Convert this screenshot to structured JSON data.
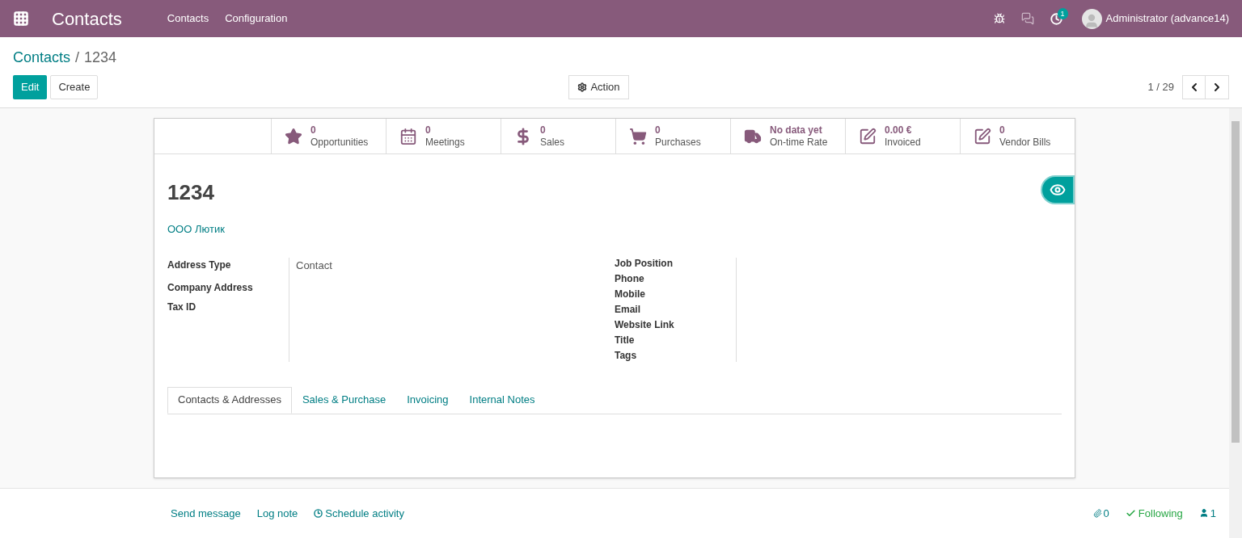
{
  "navbar": {
    "app_title": "Contacts",
    "menu": [
      "Contacts",
      "Configuration"
    ],
    "activity_count": "1",
    "user": "Administrator (advance14)"
  },
  "breadcrumb": {
    "parent": "Contacts",
    "separator": "/",
    "current": "1234"
  },
  "buttons": {
    "edit": "Edit",
    "create": "Create",
    "action": "Action"
  },
  "pager": {
    "value": "1 / 29"
  },
  "stat_buttons": [
    {
      "kind": "star",
      "value": "0",
      "label": "Opportunities"
    },
    {
      "kind": "calendar",
      "value": "0",
      "label": "Meetings"
    },
    {
      "kind": "dollar",
      "value": "0",
      "label": "Sales"
    },
    {
      "kind": "cart",
      "value": "0",
      "label": "Purchases"
    },
    {
      "kind": "truck",
      "value": "No data yet",
      "label": "On-time Rate"
    },
    {
      "kind": "pen",
      "value": "0.00 €",
      "label": "Invoiced"
    },
    {
      "kind": "pen",
      "value": "0",
      "label": "Vendor Bills"
    }
  ],
  "record": {
    "name": "1234",
    "company": "ООО Лютик"
  },
  "left_fields": [
    {
      "label": "Address Type",
      "value": "Contact"
    },
    {
      "label": "Company Address"
    },
    {
      "label": "Tax ID"
    }
  ],
  "right_fields": [
    {
      "label": "Job Position"
    },
    {
      "label": "Phone"
    },
    {
      "label": "Mobile"
    },
    {
      "label": "Email"
    },
    {
      "label": "Website Link"
    },
    {
      "label": "Title"
    },
    {
      "label": "Tags"
    }
  ],
  "tabs": [
    {
      "label": "Contacts & Addresses",
      "selected": true
    },
    {
      "label": "Sales & Purchase",
      "selected": false
    },
    {
      "label": "Invoicing",
      "selected": false
    },
    {
      "label": "Internal Notes",
      "selected": false
    }
  ],
  "chatter": {
    "actions": [
      "Send message",
      "Log note"
    ],
    "schedule": "Schedule activity",
    "attachments": "0",
    "following": "Following",
    "followers": "1"
  }
}
